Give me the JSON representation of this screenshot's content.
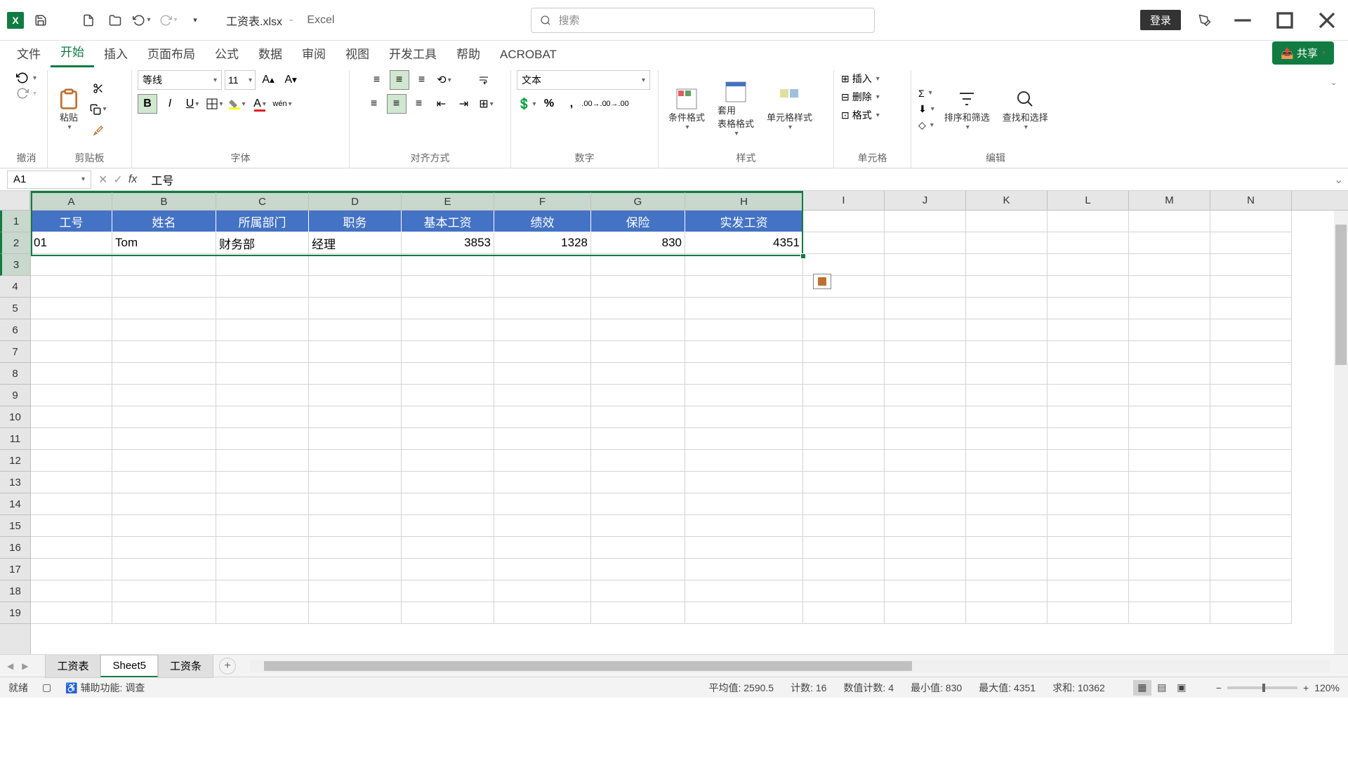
{
  "titlebar": {
    "filename": "工资表.xlsx",
    "appname": "Excel",
    "search_placeholder": "搜索",
    "login": "登录"
  },
  "tabs": {
    "file": "文件",
    "home": "开始",
    "insert": "插入",
    "layout": "页面布局",
    "formulas": "公式",
    "data": "数据",
    "review": "审阅",
    "view": "视图",
    "dev": "开发工具",
    "help": "帮助",
    "acrobat": "ACROBAT",
    "share": "共享"
  },
  "ribbon": {
    "undo": "撤消",
    "clipboard": "剪贴板",
    "paste": "粘贴",
    "font_group": "字体",
    "font_name": "等线",
    "font_size": "11",
    "align_group": "对齐方式",
    "number_group": "数字",
    "number_format": "文本",
    "styles_group": "样式",
    "cond_fmt": "条件格式",
    "table_fmt": "套用\n表格格式",
    "cell_styles": "单元格样式",
    "cells_group": "单元格",
    "insert_btn": "插入",
    "delete_btn": "删除",
    "format_btn": "格式",
    "editing_group": "编辑",
    "sort_filter": "排序和筛选",
    "find_select": "查找和选择"
  },
  "formula_bar": {
    "name_box": "A1",
    "formula": "工号"
  },
  "columns": [
    "A",
    "B",
    "C",
    "D",
    "E",
    "F",
    "G",
    "H",
    "I",
    "J",
    "K",
    "L",
    "M",
    "N"
  ],
  "rows": [
    "1",
    "2",
    "3",
    "4",
    "5",
    "6",
    "7",
    "8",
    "9",
    "10",
    "11",
    "12",
    "13",
    "14",
    "15",
    "16",
    "17",
    "18",
    "19"
  ],
  "headers": [
    "工号",
    "姓名",
    "所属部门",
    "职务",
    "基本工资",
    "绩效",
    "保险",
    "实发工资"
  ],
  "data_row": {
    "id": "01",
    "name": "Tom",
    "dept": "财务部",
    "title": "经理",
    "base": "3853",
    "perf": "1328",
    "ins": "830",
    "net": "4351"
  },
  "sheets": {
    "s1": "工资表",
    "s2": "Sheet5",
    "s3": "工资条"
  },
  "status": {
    "ready": "就绪",
    "access": "辅助功能: 调查",
    "avg": "平均值: 2590.5",
    "count": "计数: 16",
    "numcount": "数值计数: 4",
    "min": "最小值: 830",
    "max": "最大值: 4351",
    "sum": "求和: 10362",
    "zoom": "120%"
  }
}
